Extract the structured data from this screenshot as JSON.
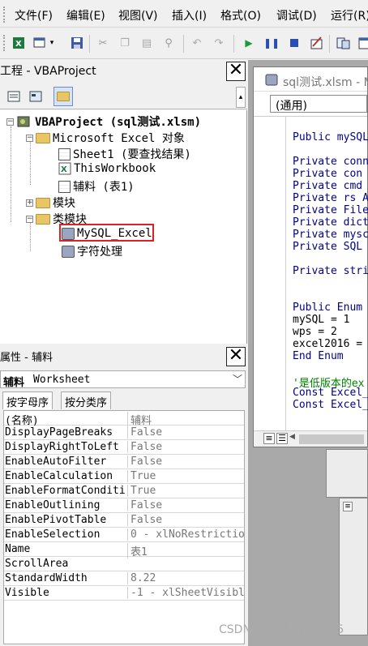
{
  "menu": {
    "items": [
      "文件(F)",
      "编辑(E)",
      "视图(V)",
      "插入(I)",
      "格式(O)",
      "调试(D)",
      "运行(R)"
    ]
  },
  "toolbar": {
    "icons": [
      "excel-icon",
      "insert-form-icon",
      "save-icon",
      "cut-icon",
      "copy-icon",
      "paste-icon",
      "find-icon",
      "undo-icon",
      "redo-icon",
      "run-icon",
      "pause-icon",
      "stop-icon",
      "design-mode-icon",
      "project-explorer-icon",
      "properties-icon"
    ]
  },
  "project_panel": {
    "title": "工程 - VBAProject",
    "close": "✕",
    "tree": {
      "root": "VBAProject (sql测试.xlsm)",
      "excel_objects": "Microsoft Excel 对象",
      "sheet1": "Sheet1 (要查找结果)",
      "thisworkbook": "ThisWorkbook",
      "fuliao": "辅料 (表1)",
      "modules": "模块",
      "class_modules": "类模块",
      "mysql_excel": "MySQL_Excel",
      "string_proc": "字符处理"
    }
  },
  "properties_panel": {
    "title": "属性 - 辅料",
    "close": "✕",
    "object_name": "辅料",
    "object_type": "Worksheet",
    "tab_alpha": "按字母序",
    "tab_category": "按分类序",
    "rows": [
      {
        "name": "(名称)",
        "value": "辅料"
      },
      {
        "name": "DisplayPageBreaks",
        "value": "False"
      },
      {
        "name": "DisplayRightToLeft",
        "value": "False"
      },
      {
        "name": "EnableAutoFilter",
        "value": "False"
      },
      {
        "name": "EnableCalculation",
        "value": "True"
      },
      {
        "name": "EnableFormatConditi",
        "value": "True"
      },
      {
        "name": "EnableOutlining",
        "value": "False"
      },
      {
        "name": "EnablePivotTable",
        "value": "False"
      },
      {
        "name": "EnableSelection",
        "value": "0 - xlNoRestrictio"
      },
      {
        "name": "Name",
        "value": "表1"
      },
      {
        "name": "ScrollArea",
        "value": ""
      },
      {
        "name": "StandardWidth",
        "value": "8.22"
      },
      {
        "name": "Visible",
        "value": "-1 - xlSheetVisibl"
      }
    ]
  },
  "code_window": {
    "title": "sql测试.xlsm - M",
    "combo": "(通用)",
    "lines": [
      {
        "text": "Public mySQL",
        "comment": false
      },
      {
        "text": "",
        "comment": false
      },
      {
        "text": "Private conn",
        "comment": false
      },
      {
        "text": "Private con",
        "comment": false
      },
      {
        "text": "Private cmd",
        "comment": false
      },
      {
        "text": "Private rs A",
        "comment": false
      },
      {
        "text": "Private File",
        "comment": false
      },
      {
        "text": "Private dict",
        "comment": false
      },
      {
        "text": "Private mysc",
        "comment": false
      },
      {
        "text": "Private SQL",
        "comment": false
      },
      {
        "text": "",
        "comment": false
      },
      {
        "text": "Private stri",
        "comment": false
      },
      {
        "text": "",
        "comment": false
      },
      {
        "text": "",
        "comment": false
      },
      {
        "text": "Public Enum",
        "comment": false
      },
      {
        "text": "mySQL = 1",
        "comment": false
      },
      {
        "text": "wps = 2",
        "comment": false
      },
      {
        "text": "excel2016 =",
        "comment": false
      },
      {
        "text": "End Enum",
        "comment": false
      },
      {
        "text": "",
        "comment": false
      },
      {
        "text": "'是低版本的ex",
        "comment": true
      },
      {
        "text": "Const Excel_",
        "comment": false
      },
      {
        "text": "Const Excel_",
        "comment": false
      }
    ]
  },
  "watermark": "CSDN @qq_43746935"
}
